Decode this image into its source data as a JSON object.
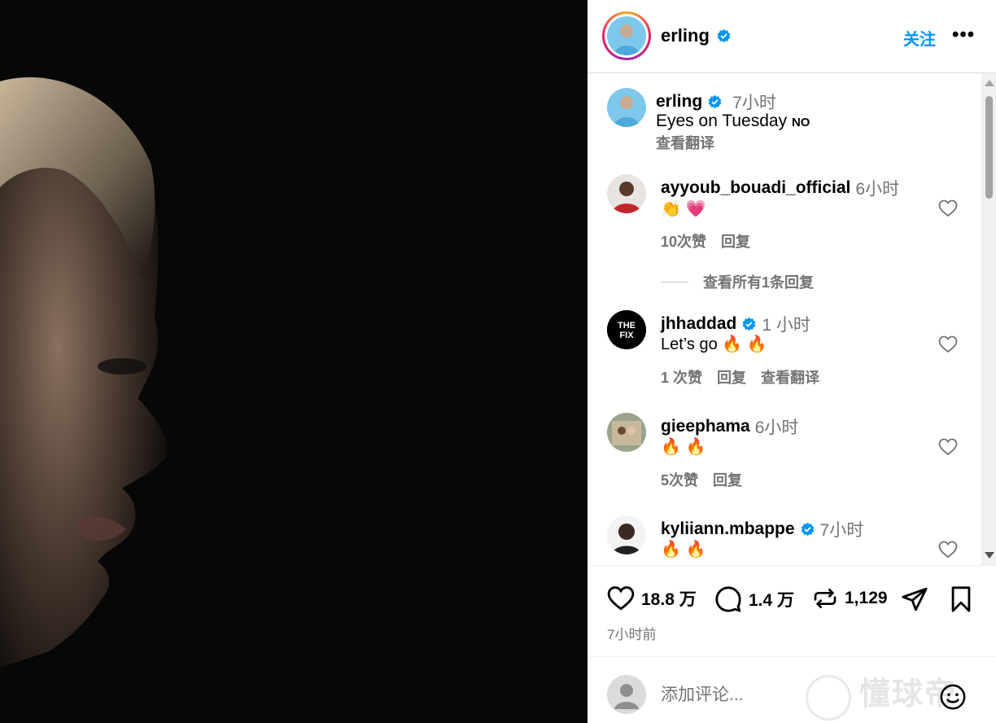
{
  "header": {
    "username": "erling",
    "follow_label": "关注",
    "more_label": "•••"
  },
  "caption": {
    "username": "erling",
    "time": "7小时",
    "text": "Eyes on Tuesday",
    "text_suffix": "NO",
    "translate_label": "查看翻译"
  },
  "comments": [
    {
      "username": "ayyoub_bouadi_official",
      "verified": false,
      "time": "6小时",
      "text": "👏 💗",
      "likes": "10次赞",
      "reply": "回复",
      "extra": ""
    },
    {
      "username": "jhhaddad",
      "verified": true,
      "time": "1 小时",
      "text": "Let’s go 🔥 🔥",
      "likes": "1 次赞",
      "reply": "回复",
      "extra": "查看翻译"
    },
    {
      "username": "gieephama",
      "verified": false,
      "time": "6小时",
      "text": "🔥 🔥",
      "likes": "5次赞",
      "reply": "回复",
      "extra": ""
    },
    {
      "username": "kyliiann.mbappe",
      "verified": true,
      "time": "7小时",
      "text": "🔥 🔥",
      "likes": "",
      "reply": "",
      "extra": ""
    }
  ],
  "view_replies_label": "查看所有1条回复",
  "actions": {
    "likes": "18.8 万",
    "comments": "1.4 万",
    "reposts": "1,129"
  },
  "post_time": "7小时前",
  "comment_box": {
    "placeholder": "添加评论..."
  },
  "watermark": "懂球帝",
  "colors": {
    "accent": "#0095f6",
    "verified": "#0095f6",
    "secondary_text": "#737373"
  }
}
